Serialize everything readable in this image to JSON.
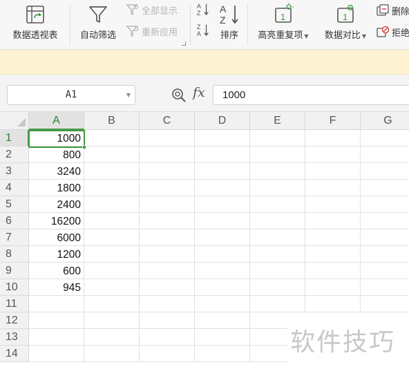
{
  "ribbon": {
    "pivot_label": "数据透视表",
    "autofilter_label": "自动筛选",
    "show_all_label": "全部显示",
    "reapply_label": "重新应用",
    "sort_label": "排序",
    "highlight_dup_label": "高亮重复项",
    "compare_label": "数据对比",
    "delete_dup_label": "删除",
    "reject_dup_label": "拒绝"
  },
  "formula_bar": {
    "name_box": "A1",
    "fx_symbol": "fx",
    "formula_value": "1000"
  },
  "sheet": {
    "columns": [
      "A",
      "B",
      "C",
      "D",
      "E",
      "F",
      "G"
    ],
    "rows": [
      "1",
      "2",
      "3",
      "4",
      "5",
      "6",
      "7",
      "8",
      "9",
      "10",
      "11",
      "12",
      "13",
      "14"
    ],
    "col_a_values": [
      "1000",
      "800",
      "3240",
      "1800",
      "2400",
      "16200",
      "6000",
      "1200",
      "600",
      "945"
    ],
    "active_cell": "A1"
  },
  "watermark": "软件技巧",
  "colors": {
    "accent_green": "#3f9a40",
    "notice_bg": "#fdf3d2"
  }
}
